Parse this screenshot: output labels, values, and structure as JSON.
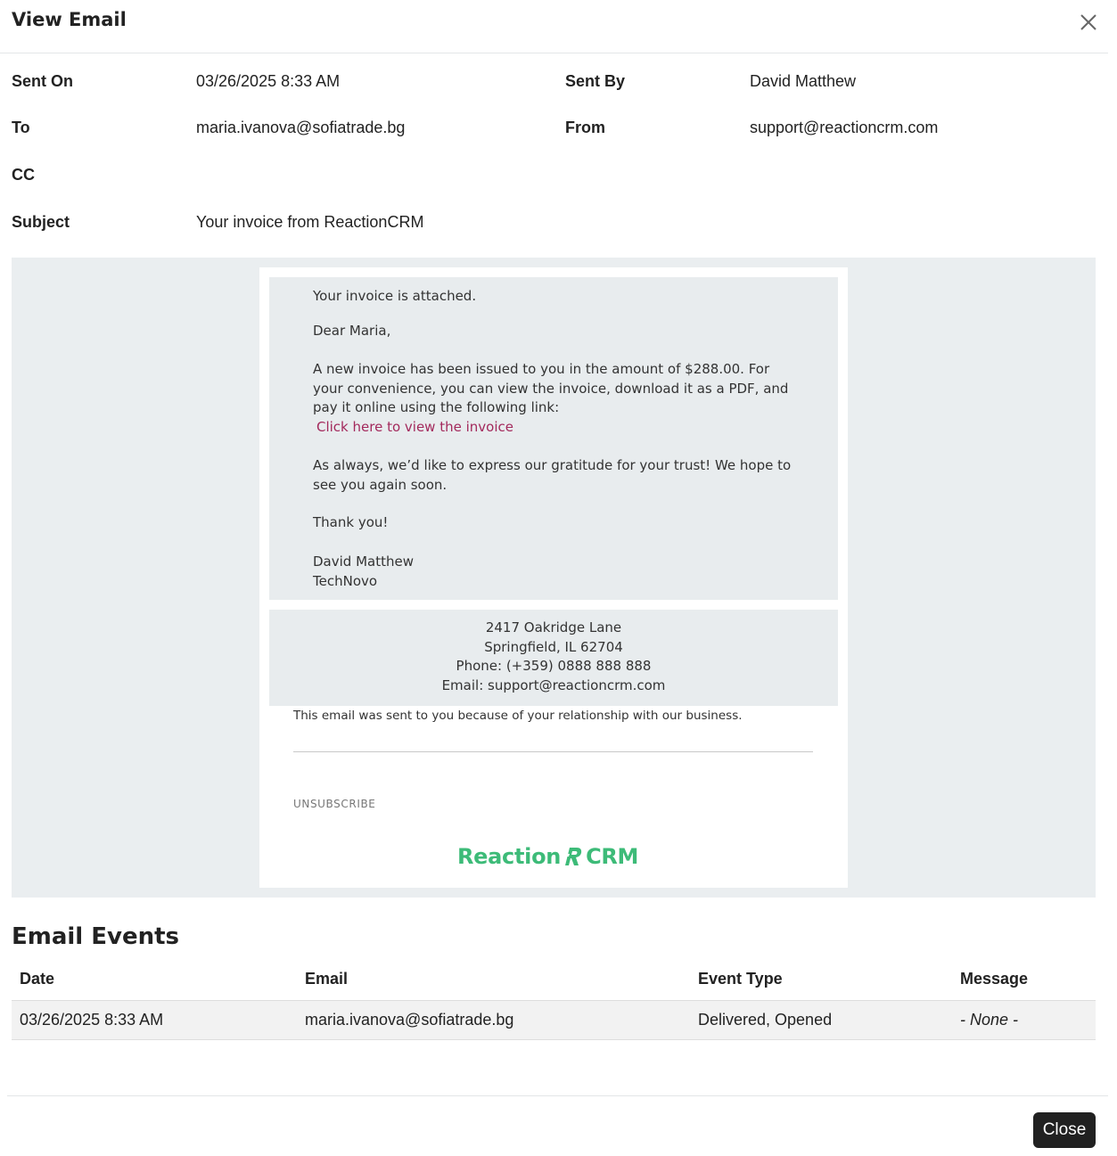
{
  "modal": {
    "title": "View Email",
    "close_label": "Close"
  },
  "meta": {
    "sent_on_label": "Sent On",
    "sent_on_value": "03/26/2025 8:33 AM",
    "sent_by_label": "Sent By",
    "sent_by_value": "David Matthew",
    "to_label": "To",
    "to_value": "maria.ivanova@sofiatrade.bg",
    "from_label": "From",
    "from_value": "support@reactioncrm.com",
    "cc_label": "CC",
    "cc_value": "",
    "subject_label": "Subject",
    "subject_value": "Your invoice from ReactionCRM"
  },
  "email_body": {
    "intro": "Your invoice is attached.",
    "greeting": "Dear Maria,",
    "paragraph1": "A new invoice has been issued to you in the amount of $288.00. For your convenience, you can view the invoice, download it as a PDF, and pay it online using the following link:",
    "link_text": "Click here to view the invoice",
    "paragraph2": "As always, we’d like to express our gratitude for your trust! We hope to see you again soon.",
    "thanks": "Thank you!",
    "signature_name": "David Matthew",
    "signature_company": "TechNovo",
    "link_color": "#a3295c"
  },
  "email_footer": {
    "address_line1": "2417 Oakridge Lane",
    "address_line2": "Springfield, IL 62704",
    "phone": "Phone: (+359) 0888 888 888",
    "email": "Email: support@reactioncrm.com",
    "notice": "This email was sent to you because of your relationship with our business.",
    "unsubscribe": "UNSUBSCRIBE",
    "logo_left": "Reaction",
    "logo_right": "CRM",
    "logo_color": "#3dbb78"
  },
  "events": {
    "title": "Email Events",
    "columns": [
      "Date",
      "Email",
      "Event Type",
      "Message"
    ],
    "rows": [
      [
        "03/26/2025 8:33 AM",
        "maria.ivanova@sofiatrade.bg",
        "Delivered, Opened",
        "- None -"
      ]
    ]
  },
  "icons": {
    "close": "close-icon",
    "logo_mark": "reaction-logo-icon"
  }
}
